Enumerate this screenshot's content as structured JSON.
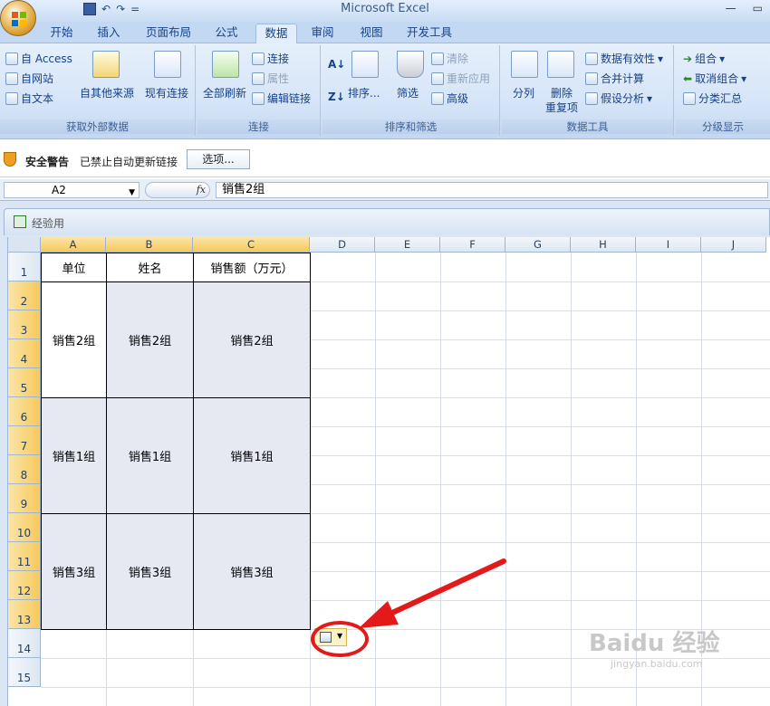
{
  "app": {
    "title": "Microsoft Excel",
    "qat_undo": "↶",
    "qat_redo": "↷",
    "qat_more": "="
  },
  "tabs": [
    "开始",
    "插入",
    "页面布局",
    "公式",
    "数据",
    "审阅",
    "视图",
    "开发工具"
  ],
  "active_tab": "数据",
  "ribbon": {
    "external": {
      "label": "获取外部数据",
      "access": "自 Access",
      "web": "自网站",
      "text": "自文本",
      "other": "自其他来源",
      "existing": "现有连接"
    },
    "connections": {
      "label": "连接",
      "refresh_all": "全部刷新",
      "connections": "连接",
      "properties": "属性",
      "edit_links": "编辑链接"
    },
    "sort_filter": {
      "label": "排序和筛选",
      "sort": "排序...",
      "filter": "筛选",
      "clear": "清除",
      "reapply": "重新应用",
      "advanced": "高级"
    },
    "data_tools": {
      "label": "数据工具",
      "split": "分列",
      "remove_dup_1": "删除",
      "remove_dup_2": "重复项",
      "validation": "数据有效性",
      "consolidate": "合并计算",
      "whatif": "假设分析"
    },
    "outline": {
      "label": "分级显示",
      "group": "组合",
      "ungroup": "取消组合",
      "subtotal": "分类汇总"
    }
  },
  "security": {
    "title": "安全警告",
    "message": "已禁止自动更新链接",
    "button": "选项..."
  },
  "formula_bar": {
    "name_box": "A2",
    "fx": "fx",
    "value": "销售2组"
  },
  "workbook": {
    "name": "经验用"
  },
  "sheet": {
    "columns": [
      "A",
      "B",
      "C",
      "D",
      "E",
      "F",
      "G",
      "H",
      "I",
      "J"
    ],
    "selected_columns": [
      "A",
      "B",
      "C"
    ],
    "rows": [
      "1",
      "2",
      "3",
      "4",
      "5",
      "6",
      "7",
      "8",
      "9",
      "10",
      "11",
      "12",
      "13",
      "14",
      "15"
    ],
    "headers": [
      "单位",
      "姓名",
      "销售额（万元）"
    ],
    "blocks": [
      [
        "销售2组",
        "销售2组",
        "销售2组"
      ],
      [
        "销售1组",
        "销售1组",
        "销售1组"
      ],
      [
        "销售3组",
        "销售3组",
        "销售3组"
      ]
    ]
  },
  "watermark": {
    "text": "Baidu 经验",
    "url": "jingyan.baidu.com"
  }
}
